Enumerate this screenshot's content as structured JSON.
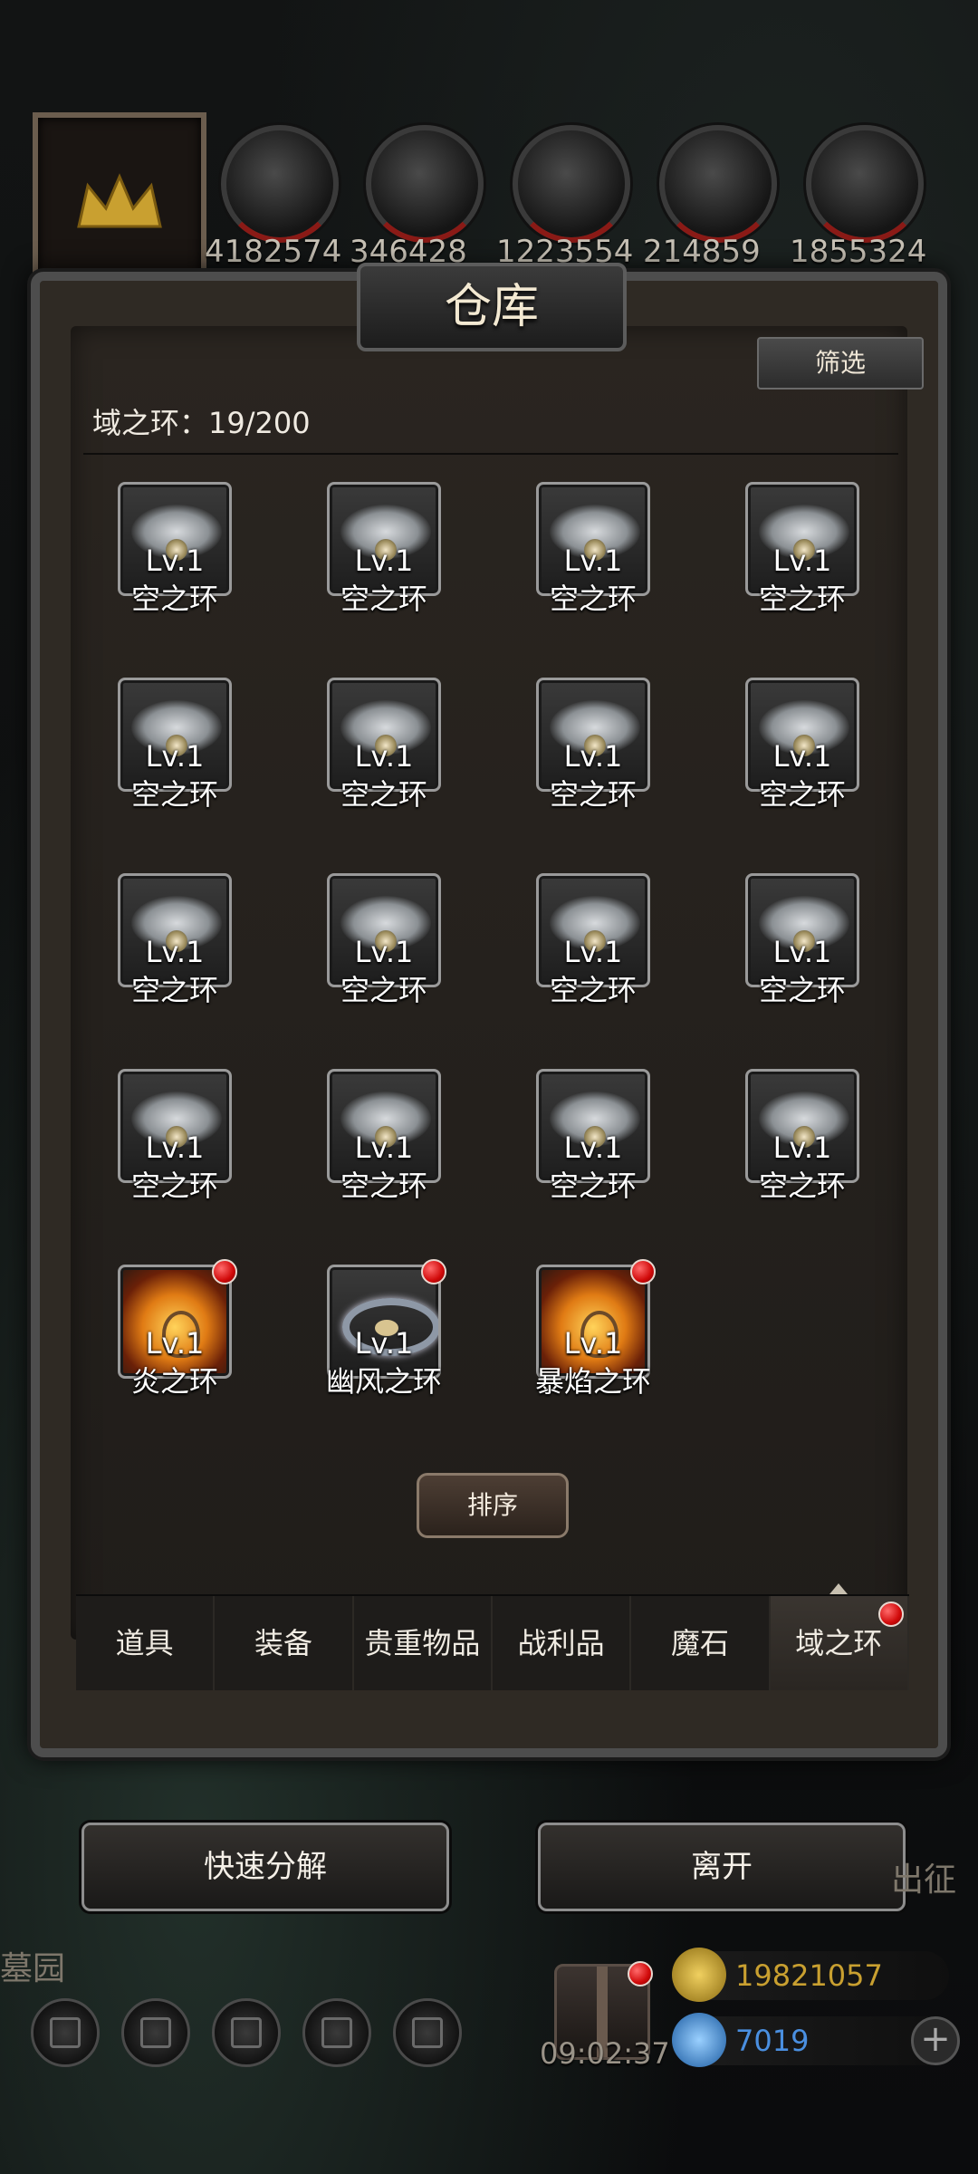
{
  "resources": [
    {
      "icon": "meat-icon",
      "value": "4182574"
    },
    {
      "icon": "wood-icon",
      "value": "346428"
    },
    {
      "icon": "iron-icon",
      "value": "1223554"
    },
    {
      "icon": "crystal-icon",
      "value": "214859"
    },
    {
      "icon": "ore-icon",
      "value": "1855324"
    }
  ],
  "warehouse": {
    "title": "仓库",
    "filter_label": "筛选",
    "count_label": "域之环：19/200",
    "items": [
      {
        "lv": "Lv.1",
        "name": "空之环",
        "type": "cloud"
      },
      {
        "lv": "Lv.1",
        "name": "空之环",
        "type": "cloud"
      },
      {
        "lv": "Lv.1",
        "name": "空之环",
        "type": "cloud"
      },
      {
        "lv": "Lv.1",
        "name": "空之环",
        "type": "cloud"
      },
      {
        "lv": "Lv.1",
        "name": "空之环",
        "type": "cloud"
      },
      {
        "lv": "Lv.1",
        "name": "空之环",
        "type": "cloud"
      },
      {
        "lv": "Lv.1",
        "name": "空之环",
        "type": "cloud"
      },
      {
        "lv": "Lv.1",
        "name": "空之环",
        "type": "cloud"
      },
      {
        "lv": "Lv.1",
        "name": "空之环",
        "type": "cloud"
      },
      {
        "lv": "Lv.1",
        "name": "空之环",
        "type": "cloud"
      },
      {
        "lv": "Lv.1",
        "name": "空之环",
        "type": "cloud"
      },
      {
        "lv": "Lv.1",
        "name": "空之环",
        "type": "cloud"
      },
      {
        "lv": "Lv.1",
        "name": "空之环",
        "type": "cloud"
      },
      {
        "lv": "Lv.1",
        "name": "空之环",
        "type": "cloud"
      },
      {
        "lv": "Lv.1",
        "name": "空之环",
        "type": "cloud"
      },
      {
        "lv": "Lv.1",
        "name": "空之环",
        "type": "cloud"
      },
      {
        "lv": "Lv.1",
        "name": "炎之环",
        "type": "fire",
        "badge": true
      },
      {
        "lv": "Lv.1",
        "name": "幽风之环",
        "type": "ring",
        "badge": true
      },
      {
        "lv": "Lv.1",
        "name": "暴焰之环",
        "type": "fire",
        "badge": true
      }
    ],
    "tabs": [
      {
        "label": "道具"
      },
      {
        "label": "装备"
      },
      {
        "label": "贵重物品"
      },
      {
        "label": "战利品"
      },
      {
        "label": "魔石"
      },
      {
        "label": "域之环",
        "active": true,
        "badge": true
      }
    ],
    "sort_label": "排序"
  },
  "actions": {
    "decompose_label": "快速分解",
    "leave_label": "离开"
  },
  "bottom": {
    "left_label": "墓园",
    "right_label": "出征",
    "gift_timer": "09:02:37",
    "gold": "19821057",
    "gems": "7019",
    "colors": {
      "gold": "#c9a030",
      "gems": "#4a8fe0",
      "badge": "#d10a0a"
    }
  }
}
